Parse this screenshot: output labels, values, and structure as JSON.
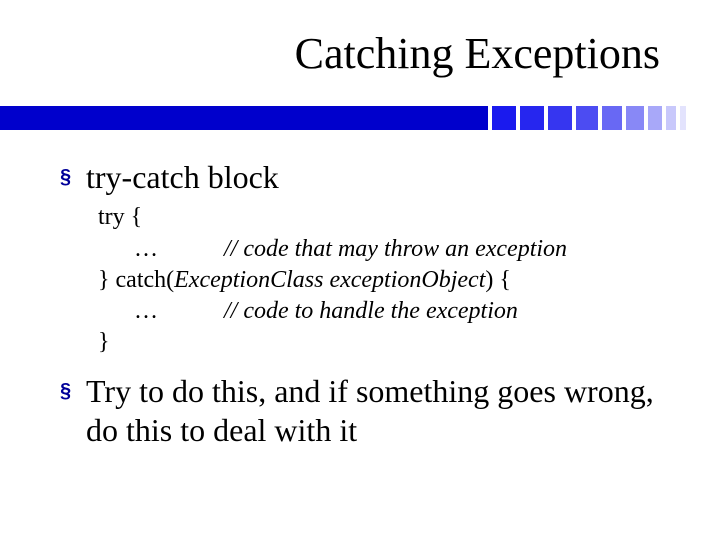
{
  "title": "Catching Exceptions",
  "bullets": {
    "b1": "try-catch block",
    "b2": "Try to do this, and if something goes wrong, do this to deal with it"
  },
  "code": {
    "l1_a": "try {",
    "l2_a": "      …           ",
    "l2_b": "// code that may throw an exception",
    "l3_a": "} catch(",
    "l3_b": "ExceptionClass exceptionObject",
    "l3_c": ") {",
    "l4_a": "      …           ",
    "l4_b": "// code to handle the exception",
    "l5_a": "}"
  },
  "bullet_glyph": "§"
}
